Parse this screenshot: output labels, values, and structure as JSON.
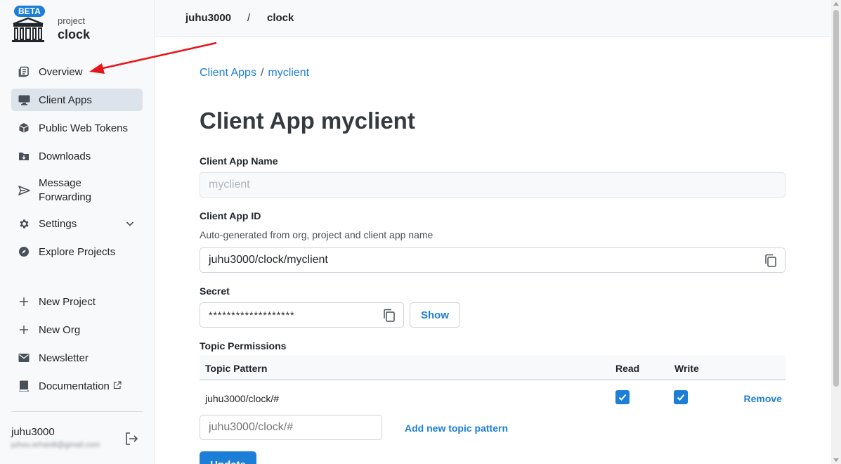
{
  "brand": {
    "badge": "BETA",
    "subtitle": "project",
    "name": "clock"
  },
  "sidebar": {
    "items": [
      {
        "label": "Overview",
        "icon": "overview-icon"
      },
      {
        "label": "Client Apps",
        "icon": "monitor-icon",
        "active": true
      },
      {
        "label": "Public Web Tokens",
        "icon": "cube-icon"
      },
      {
        "label": "Downloads",
        "icon": "folder-download-icon"
      },
      {
        "label": "Message\nForwarding",
        "icon": "send-icon"
      },
      {
        "label": "Settings",
        "icon": "gear-icon"
      },
      {
        "label": "Explore Projects",
        "icon": "compass-icon"
      },
      {
        "label": "New Project",
        "icon": "plus-icon"
      },
      {
        "label": "New Org",
        "icon": "plus-icon"
      },
      {
        "label": "Newsletter",
        "icon": "mail-icon"
      },
      {
        "label": "Documentation",
        "icon": "book-icon"
      }
    ],
    "user": {
      "name": "juhu3000",
      "email": "juhou.erhardt@gmail.com"
    }
  },
  "topbar": {
    "org": "juhu3000",
    "separator": "/",
    "project": "clock"
  },
  "main": {
    "breadcrumb": {
      "parent": "Client Apps",
      "separator": "/",
      "current": "myclient"
    },
    "title": "Client App myclient",
    "name_field": {
      "label": "Client App Name",
      "value": "myclient"
    },
    "id_field": {
      "label": "Client App ID",
      "description": "Auto-generated from org, project and client app name",
      "value": "juhu3000/clock/myclient"
    },
    "secret_field": {
      "label": "Secret",
      "value": "*******************",
      "show_label": "Show"
    },
    "topics": {
      "label": "Topic Permissions",
      "headers": {
        "pattern": "Topic Pattern",
        "read": "Read",
        "write": "Write"
      },
      "rows": [
        {
          "pattern": "juhu3000/clock/#",
          "read": true,
          "write": true,
          "remove_label": "Remove"
        }
      ],
      "new_placeholder": "juhu3000/clock/#",
      "add_label": "Add new topic pattern"
    },
    "update_label": "Update"
  },
  "colors": {
    "accent": "#1c7ed6",
    "annotation": "#e8141c"
  }
}
